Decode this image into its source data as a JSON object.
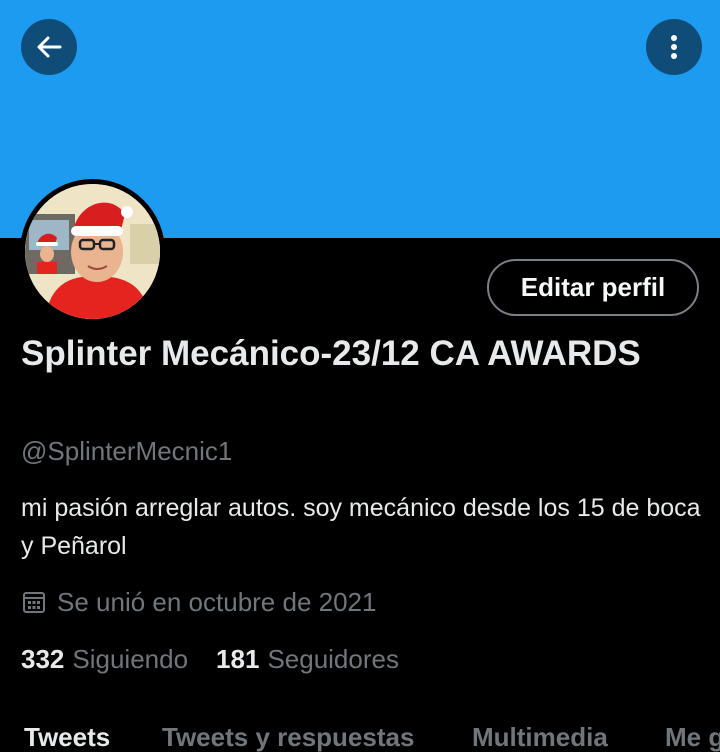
{
  "header": {
    "back_icon": "arrow-left-icon",
    "more_icon": "vertical-dots-icon",
    "banner_color": "#1d9bf0"
  },
  "profile": {
    "avatar_description": "avatar-photo",
    "edit_button": "Editar perfil",
    "name": "Splinter Mecánico-23/12 CA AWARDS",
    "handle": "@SplinterMecnic1",
    "bio": "mi pasión arreglar autos. soy mecánico desde los 15 de boca y Peñarol",
    "joined_icon": "calendar-icon",
    "joined": "Se unió en octubre de 2021",
    "following_count": "332",
    "following_label": "Siguiendo",
    "followers_count": "181",
    "followers_label": "Seguidores"
  },
  "tabs": [
    {
      "label": "Tweets",
      "active": true
    },
    {
      "label": "Tweets y respuestas",
      "active": false
    },
    {
      "label": "Multimedia",
      "active": false
    },
    {
      "label": "Me g",
      "active": false
    }
  ]
}
